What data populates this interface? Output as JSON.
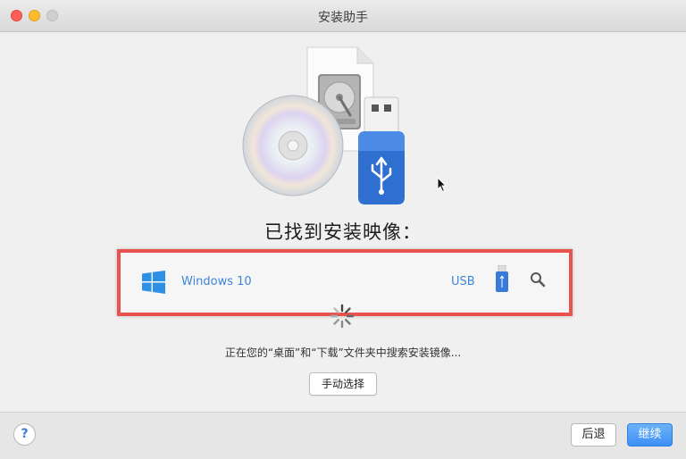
{
  "window": {
    "title": "安装助手"
  },
  "main": {
    "heading": "已找到安装映像：",
    "result": {
      "os_name": "Windows 10",
      "source": "USB",
      "icons": {
        "os": "windows-logo-icon",
        "source": "usb-drive-icon",
        "action": "search-icon"
      }
    },
    "status_text": "正在您的“桌面”和“下载”文件夹中搜索安装镜像...",
    "manual_button": "手动选择"
  },
  "footer": {
    "help_label": "?",
    "back_label": "后退",
    "continue_label": "继续"
  },
  "colors": {
    "accent": "#3f85d6",
    "highlight_border": "#e8524f",
    "primary_button": "#3d8ff5"
  }
}
